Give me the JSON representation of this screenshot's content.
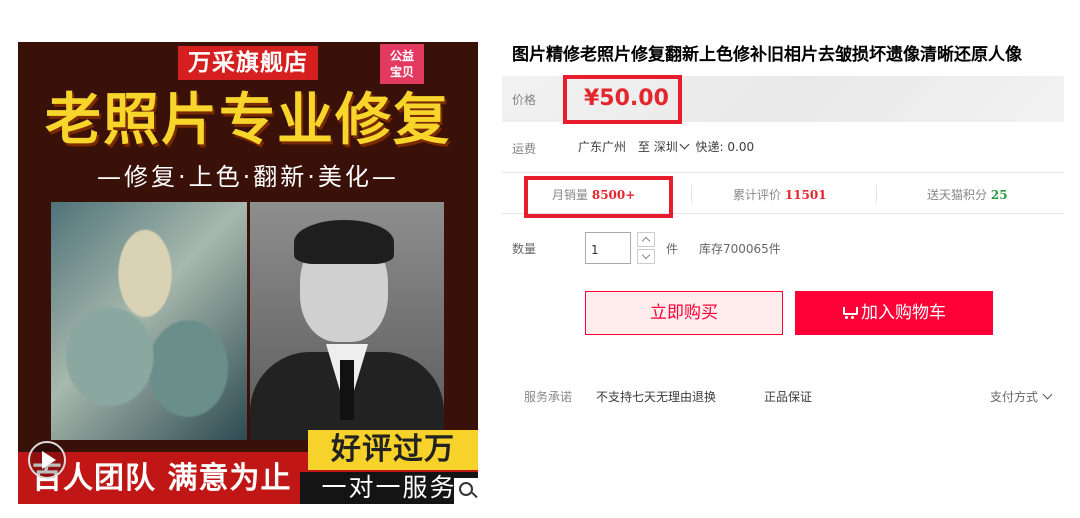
{
  "banner": {
    "store_name": "万采旗舰店",
    "charity_line1": "公益",
    "charity_line2": "宝贝",
    "headline": "老照片专业修复",
    "tagline": "—修复·上色·翻新·美化—",
    "bottom_left": "百人团队 满意为止",
    "praise": "好评过万",
    "service": "一对一服务"
  },
  "product": {
    "title": "图片精修老照片修复翻新上色修补旧相片去皱损坏遗像清晰还原人像",
    "price_label": "价格",
    "price": "¥50.00",
    "shipping_label": "运费",
    "ship_from": "广东广州",
    "ship_to_word": "至",
    "ship_dest": "深圳",
    "express": "快递: 0.00",
    "stats": {
      "monthly_sales_label": "月销量",
      "monthly_sales": "8500+",
      "reviews_label": "累计评价",
      "reviews": "11501",
      "points_label": "送天猫积分",
      "points": "25"
    },
    "quantity_label": "数量",
    "quantity_value": "1",
    "unit": "件",
    "stock": "库存700065件",
    "buy_now": "立即购买",
    "add_to_cart": "加入购物车",
    "promise_label": "服务承诺",
    "promise_1": "不支持七天无理由退换",
    "promise_2": "正品保证",
    "payment": "支付方式"
  },
  "colors": {
    "accent_red": "#ff0036",
    "price_red": "#e4262d",
    "points_green": "#2a9d3a",
    "highlight_box": "#e81c2c"
  }
}
